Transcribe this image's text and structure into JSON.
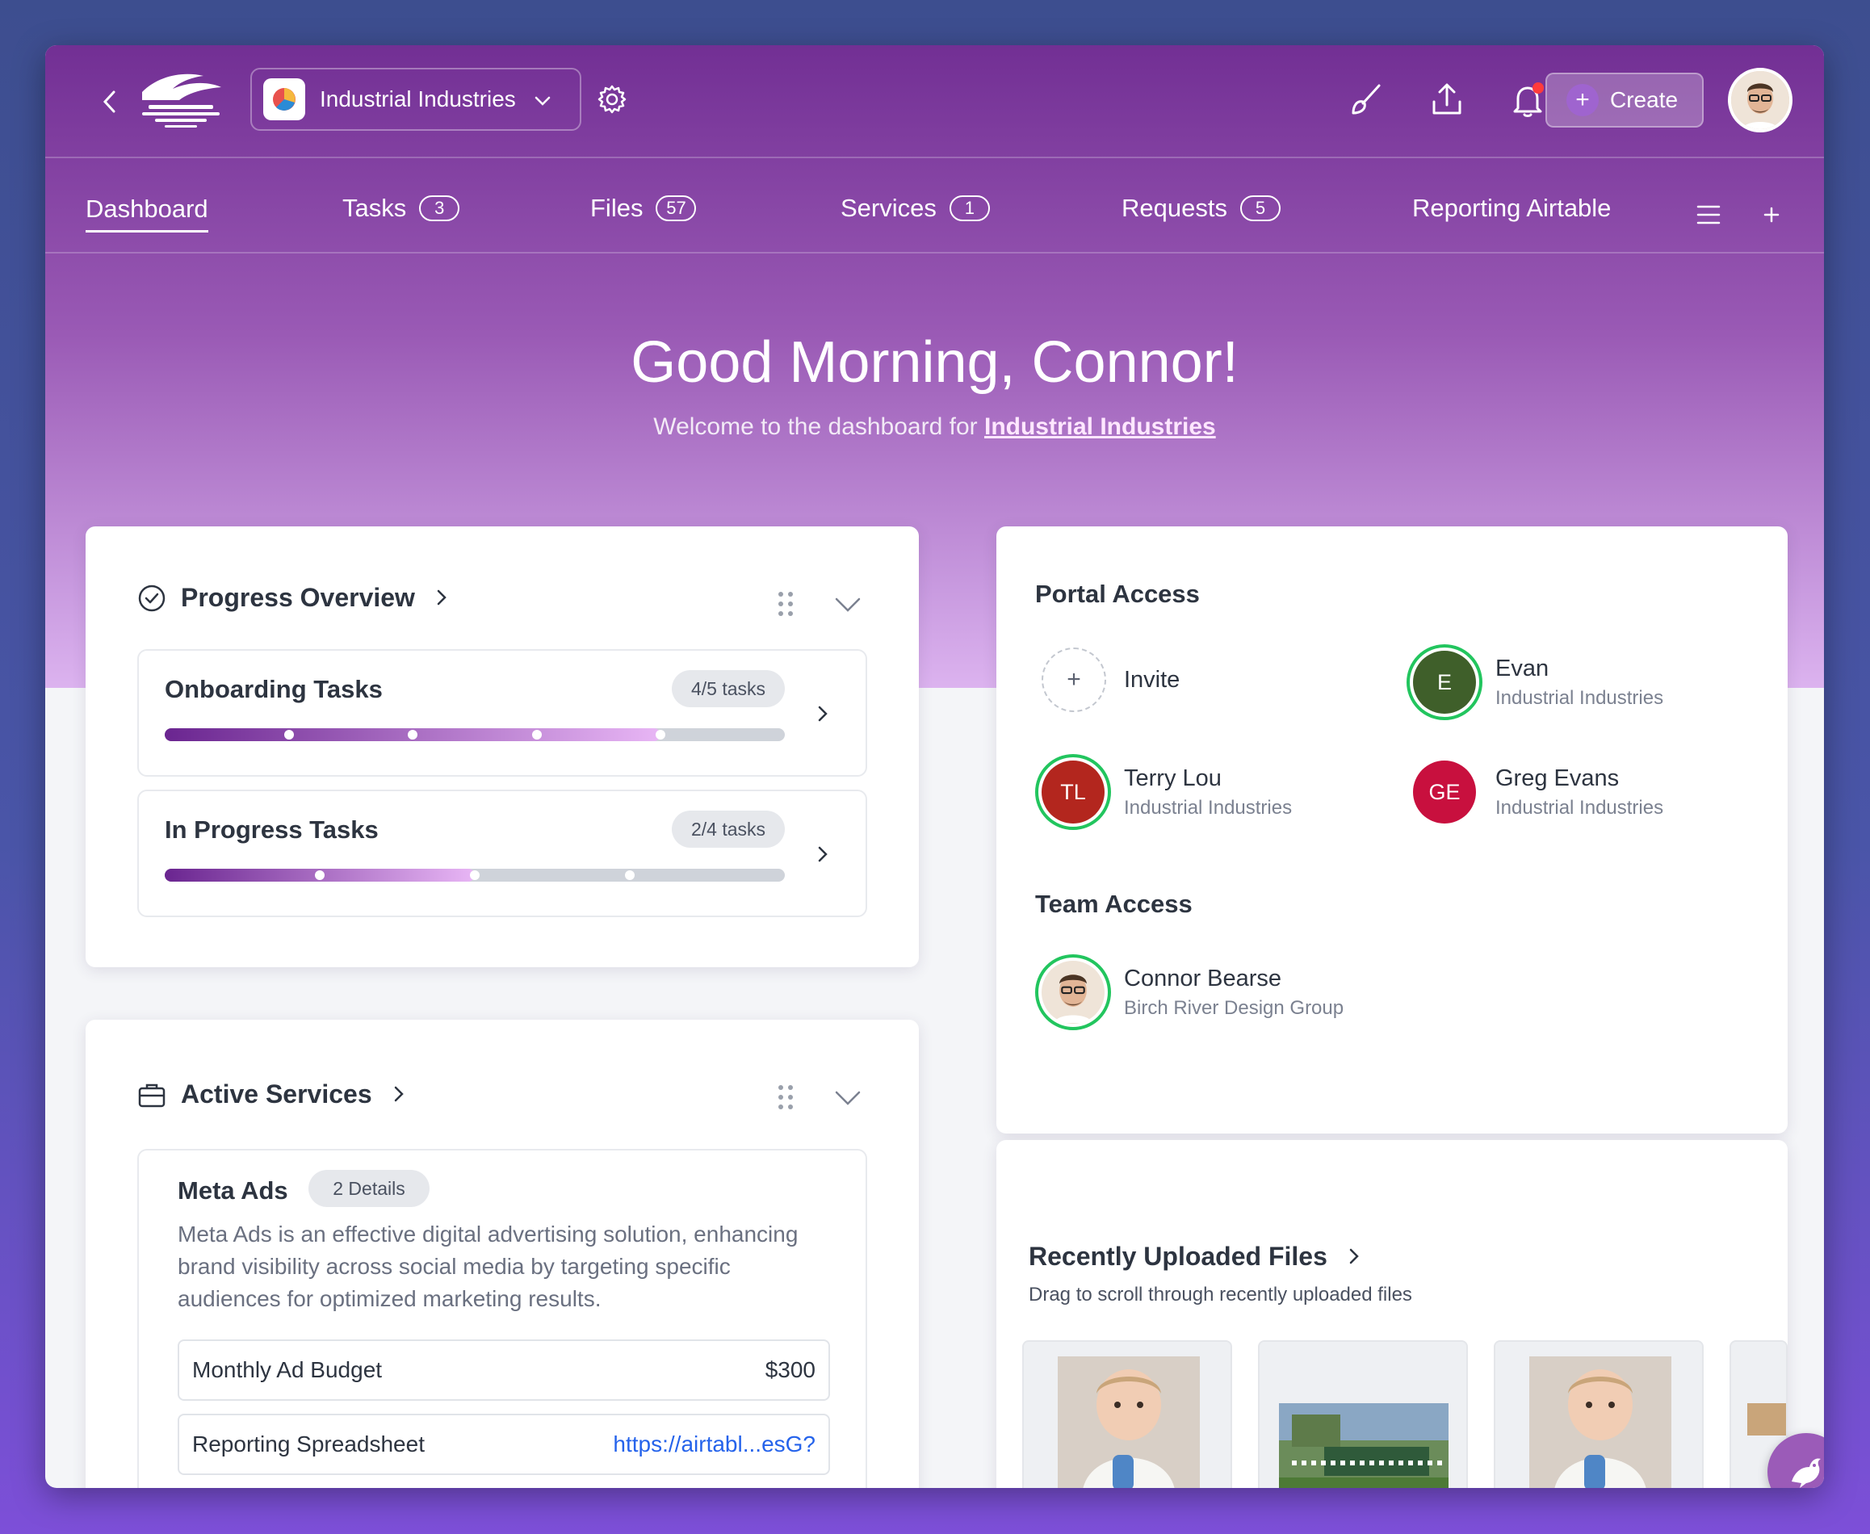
{
  "header": {
    "workspace_name": "Industrial Industries",
    "create_label": "Create"
  },
  "nav": {
    "tabs": [
      {
        "label": "Dashboard",
        "count": null
      },
      {
        "label": "Tasks",
        "count": "3"
      },
      {
        "label": "Files",
        "count": "57"
      },
      {
        "label": "Services",
        "count": "1"
      },
      {
        "label": "Requests",
        "count": "5"
      },
      {
        "label": "Reporting Airtable",
        "count": null
      }
    ]
  },
  "hero": {
    "greeting": "Good Morning, Connor!",
    "welcome_prefix": "Welcome to the dashboard for ",
    "welcome_link": "Industrial Industries"
  },
  "progress": {
    "title": "Progress Overview",
    "items": [
      {
        "label": "Onboarding Tasks",
        "pill": "4/5 tasks",
        "done": 4,
        "total": 5
      },
      {
        "label": "In Progress Tasks",
        "pill": "2/4 tasks",
        "done": 2,
        "total": 4
      }
    ]
  },
  "services": {
    "title": "Active Services",
    "service_name": "Meta Ads",
    "details_pill": "2 Details",
    "description": "Meta Ads is an effective digital advertising solution, enhancing brand visibility across social media by targeting specific audiences for optimized marketing results.",
    "fields": [
      {
        "label": "Monthly Ad Budget",
        "value": "$300"
      },
      {
        "label": "Reporting Spreadsheet",
        "value": "https://airtabl...esG?"
      }
    ]
  },
  "portal": {
    "title": "Portal Access",
    "invite_label": "Invite",
    "members": [
      {
        "initials": "E",
        "name": "Evan",
        "org": "Industrial Industries",
        "color": "#3f5f2a"
      },
      {
        "initials": "TL",
        "name": "Terry Lou",
        "org": "Industrial Industries",
        "color": "#b3261e"
      },
      {
        "initials": "GE",
        "name": "Greg Evans",
        "org": "Industrial Industries",
        "color": "#c8103e"
      }
    ],
    "team_title": "Team Access",
    "team": [
      {
        "name": "Connor Bearse",
        "org": "Birch River Design Group"
      }
    ]
  },
  "files": {
    "title": "Recently Uploaded Files",
    "subtitle": "Drag to scroll through recently uploaded files"
  },
  "colors": {
    "accent": "#722f94",
    "progress_gradient_start": "#6a2590",
    "progress_gradient_end": "#e8b6f5",
    "online_ring": "#22c55e",
    "link": "#2563eb"
  }
}
